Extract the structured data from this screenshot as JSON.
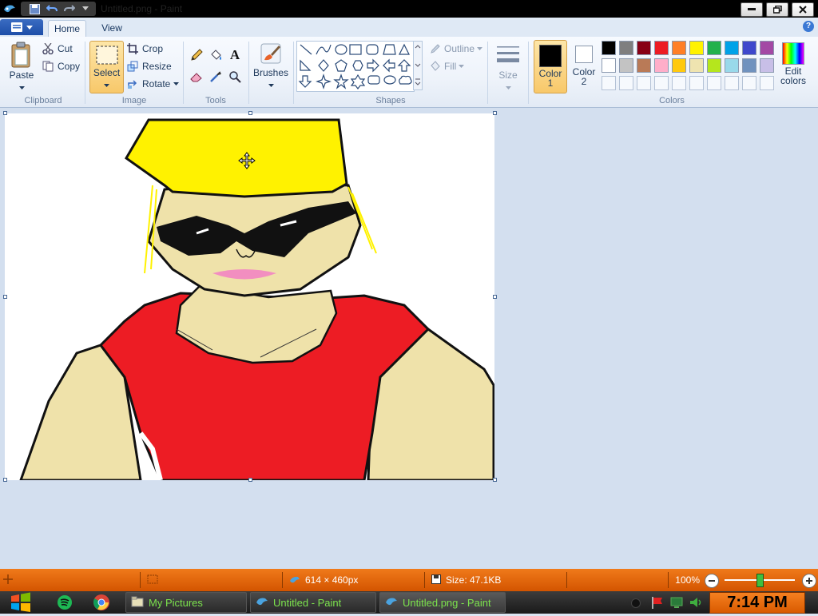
{
  "window": {
    "title": "Untitled.png - Paint"
  },
  "tabs": {
    "home": "Home",
    "view": "View"
  },
  "clipboard": {
    "paste": "Paste",
    "cut": "Cut",
    "copy": "Copy",
    "label": "Clipboard"
  },
  "image": {
    "select": "Select",
    "crop": "Crop",
    "resize": "Resize",
    "rotate": "Rotate",
    "label": "Image"
  },
  "tools": {
    "label": "Tools"
  },
  "brushes": {
    "label": "Brushes"
  },
  "shapes": {
    "outline": "Outline",
    "fill": "Fill",
    "label": "Shapes"
  },
  "size": {
    "label": "Size"
  },
  "colors": {
    "color1_label": "Color",
    "color1_num": "1",
    "color2_label": "Color",
    "color2_num": "2",
    "edit_label": "Edit",
    "edit_label2": "colors",
    "label": "Colors",
    "color1": "#000000",
    "color2": "#ffffff",
    "palette_row1": [
      "#000000",
      "#7f7f7f",
      "#880015",
      "#ed1c24",
      "#ff7f27",
      "#fff200",
      "#22b14c",
      "#00a2e8",
      "#3f48cc",
      "#a349a4"
    ],
    "palette_row2": [
      "#ffffff",
      "#c3c3c3",
      "#b97a57",
      "#ffaec9",
      "#ffc90e",
      "#efe4b0",
      "#b5e61d",
      "#99d9ea",
      "#7092be",
      "#c8bfe7"
    ]
  },
  "status": {
    "dimensions": "614 × 460px",
    "size": "Size: 47.1KB",
    "zoom": "100%"
  },
  "taskbar": {
    "items": [
      "My Pictures",
      "Untitled - Paint",
      "Untitled.png - Paint"
    ],
    "clock": "7:14 PM"
  }
}
